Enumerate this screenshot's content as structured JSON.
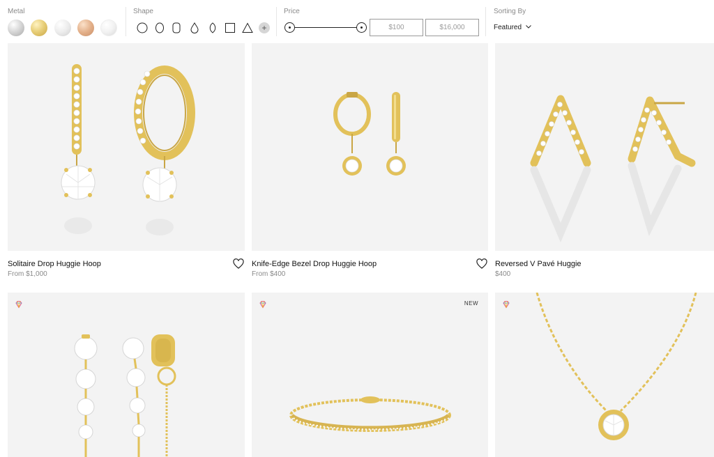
{
  "filters": {
    "metal": {
      "title": "Metal",
      "options": [
        "platinum",
        "yellow-gold",
        "white-gold",
        "rose-gold",
        "silver"
      ]
    },
    "shape": {
      "title": "Shape",
      "options": [
        "round",
        "oval",
        "cushion",
        "pear",
        "marquise",
        "emerald",
        "trillion"
      ],
      "more_label": "+"
    },
    "price": {
      "title": "Price",
      "min_value": "$100",
      "max_value": "$16,000"
    },
    "sort": {
      "title": "Sorting By",
      "selected": "Featured"
    }
  },
  "products": [
    {
      "name": "Solitaire Drop Huggie Hoop",
      "price": "From $1,000",
      "favorite": true
    },
    {
      "name": "Knife-Edge Bezel Drop Huggie Hoop",
      "price": "From $400",
      "favorite": true
    },
    {
      "name": "Reversed V Pavé Huggie",
      "price": "$400",
      "favorite": false
    },
    {
      "name": "",
      "price": "",
      "badge": "",
      "lab_grown_mark": true
    },
    {
      "name": "",
      "price": "",
      "badge": "NEW",
      "lab_grown_mark": true
    },
    {
      "name": "",
      "price": "",
      "badge": "",
      "lab_grown_mark": true
    }
  ],
  "colors": {
    "gold": "#e2c15a",
    "gold_dark": "#b8922e",
    "card_bg": "#f3f3f3",
    "muted_text": "#8a8a8a"
  }
}
